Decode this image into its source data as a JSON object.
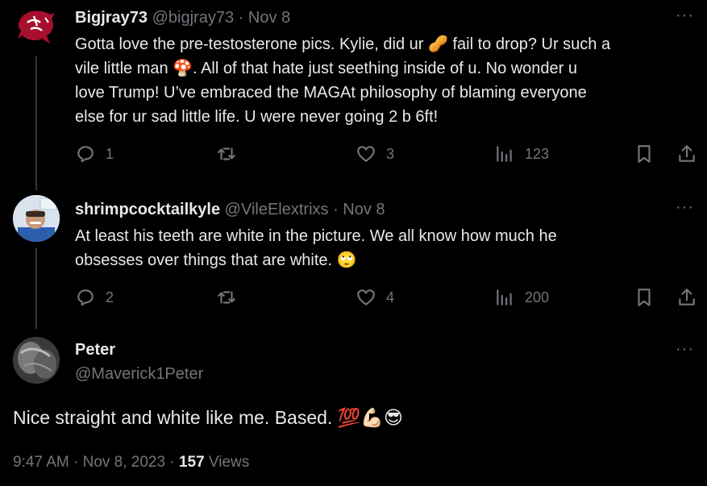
{
  "tweets": [
    {
      "name": "Bigjray73",
      "handle": "@bigjray73",
      "date": "· Nov 8",
      "more": "···",
      "text_lines": [
        "Gotta love the pre-testosterone pics. Kylie, did ur 🥜 fail to drop? Ur such a",
        "vile little man 🍄. All of that hate just seething inside of u. No wonder u",
        "love Trump! U’ve embraced the MAGAt philosophy of blaming everyone",
        "else for ur sad little life. U were never going 2 b 6ft!"
      ],
      "replies": "1",
      "reposts": "",
      "likes": "3",
      "views": "123",
      "avatar_icon": "cougar-logo-icon"
    },
    {
      "name": "shrimpcocktailkyle",
      "handle": "@VileElextrixs",
      "date": "· Nov 8",
      "more": "···",
      "text_lines": [
        "At least his teeth are white in the picture. We all know how much he",
        "obsesses over things that are white. 🙄"
      ],
      "replies": "2",
      "reposts": "",
      "likes": "4",
      "views": "200"
    }
  ],
  "main_tweet": {
    "name": "Peter",
    "handle": "@Maverick1Peter",
    "more": "···",
    "text": "Nice straight and white like me. Based. 💯💪🏻😎",
    "time": "9:47 AM · Nov 8, 2023 · ",
    "views_count": "157",
    "views_label": " Views"
  },
  "colors": {
    "background": "#000000",
    "text": "#e7e9ea",
    "muted": "#71767b",
    "thread_line": "#333639",
    "cougar_red": "#a60f2d"
  }
}
